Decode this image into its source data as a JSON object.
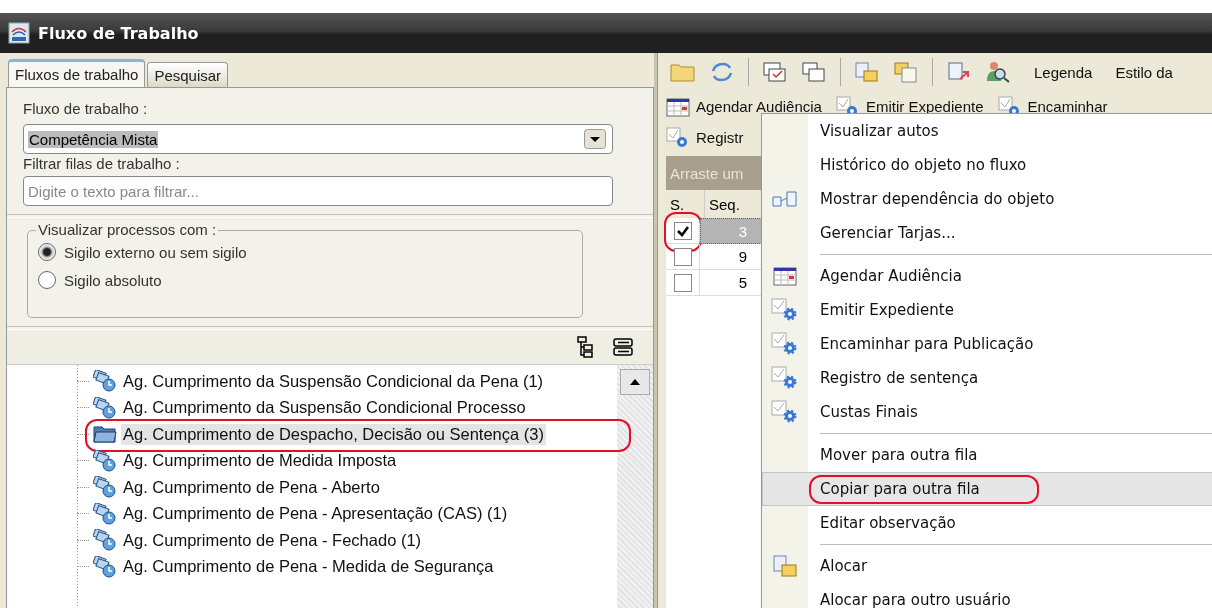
{
  "window": {
    "title": "Fluxo de Trabalho"
  },
  "left_panel": {
    "tabs": [
      {
        "label": "Fluxos de trabalho",
        "selected": true
      },
      {
        "label": "Pesquisar",
        "selected": false
      }
    ],
    "workflow_label": "Fluxo de trabalho :",
    "workflow_value": "Competência Mista",
    "filter_label": "Filtrar filas de trabalho :",
    "filter_placeholder": "Digite o texto para filtrar...",
    "visibility_group": {
      "legend": "Visualizar processos com :",
      "options": [
        {
          "label": "Sigilo externo ou sem sigilo",
          "selected": true
        },
        {
          "label": "Sigilo absoluto",
          "selected": false
        }
      ]
    },
    "queues": [
      {
        "label": "Ag. Cumprimento da Suspensão Condicional da Pena (1)",
        "selected": false,
        "circled": false
      },
      {
        "label": "Ag. Cumprimento da Suspensão Condicional  Processo",
        "selected": false,
        "circled": false
      },
      {
        "label": "Ag. Cumprimento de Despacho, Decisão ou Sentença (3)",
        "selected": true,
        "circled": true
      },
      {
        "label": "Ag. Cumprimento de Medida Imposta",
        "selected": false,
        "circled": false
      },
      {
        "label": "Ag. Cumprimento de Pena - Aberto",
        "selected": false,
        "circled": false
      },
      {
        "label": "Ag. Cumprimento de Pena - Apresentação (CAS) (1)",
        "selected": false,
        "circled": false
      },
      {
        "label": "Ag. Cumprimento de Pena - Fechado (1)",
        "selected": false,
        "circled": false
      },
      {
        "label": "Ag. Cumprimento de Pena - Medida de Segurança",
        "selected": false,
        "circled": false
      }
    ]
  },
  "right_panel": {
    "toolbar": {
      "legend_label": "Legenda",
      "style_label": "Estilo da"
    },
    "actions": [
      "Agendar Audiência",
      "Emitir Expediente",
      "Encaminhar"
    ],
    "actions_second_row": [
      "Registr"
    ],
    "group_hint": "Arraste um",
    "table": {
      "columns": [
        "S.",
        "Seq."
      ],
      "rows": [
        {
          "seq": "3",
          "checked": true,
          "selected": true,
          "circled": true
        },
        {
          "seq": "9",
          "checked": false,
          "selected": false,
          "circled": false
        },
        {
          "seq": "5",
          "checked": false,
          "selected": false,
          "circled": false
        }
      ]
    }
  },
  "context_menu": {
    "items": [
      {
        "kind": "item",
        "label": "Visualizar autos",
        "selected": false,
        "circled": false
      },
      {
        "kind": "item",
        "label": "Histórico do objeto no fluxo",
        "selected": false,
        "circled": false
      },
      {
        "kind": "item",
        "label": "Mostrar dependência do objeto",
        "selected": false,
        "circled": false
      },
      {
        "kind": "item",
        "label": "Gerenciar Tarjas...",
        "selected": false,
        "circled": false
      },
      {
        "kind": "separator"
      },
      {
        "kind": "item",
        "label": "Agendar Audiência",
        "selected": false,
        "circled": false
      },
      {
        "kind": "item",
        "label": "Emitir Expediente",
        "selected": false,
        "circled": false
      },
      {
        "kind": "item",
        "label": "Encaminhar para Publicação",
        "selected": false,
        "circled": false
      },
      {
        "kind": "item",
        "label": "Registro de sentença",
        "selected": false,
        "circled": false
      },
      {
        "kind": "item",
        "label": "Custas Finais",
        "selected": false,
        "circled": false
      },
      {
        "kind": "separator"
      },
      {
        "kind": "item",
        "label": "Mover para outra fila",
        "selected": false,
        "circled": false
      },
      {
        "kind": "item",
        "label": "Copiar para outra fila",
        "selected": true,
        "circled": true
      },
      {
        "kind": "item",
        "label": "Editar observação",
        "selected": false,
        "circled": false
      },
      {
        "kind": "separator"
      },
      {
        "kind": "item",
        "label": "Alocar",
        "selected": false,
        "circled": false
      },
      {
        "kind": "item",
        "label": "Alocar para outro usuário",
        "selected": false,
        "circled": false
      }
    ]
  }
}
